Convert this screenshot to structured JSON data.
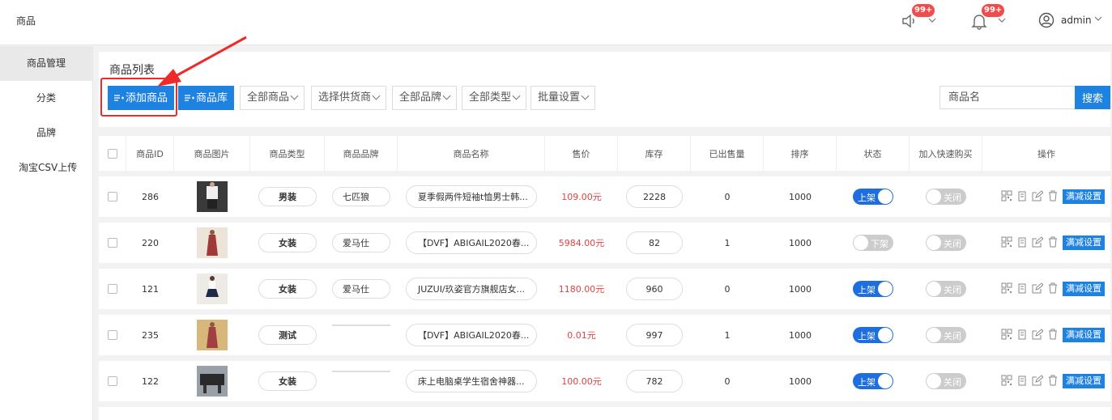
{
  "header": {
    "title": "商品",
    "notice_badge": "99+",
    "bell_badge": "99+",
    "user": "admin"
  },
  "sidebar": {
    "items": [
      {
        "label": "商品管理",
        "active": true
      },
      {
        "label": "分类"
      },
      {
        "label": "品牌"
      },
      {
        "label": "淘宝CSV上传"
      }
    ]
  },
  "panel": {
    "title": "商品列表",
    "add_label": "添加商品",
    "library_label": "商品库",
    "filters": [
      "全部商品",
      "选择供货商",
      "全部品牌",
      "全部类型",
      "批量设置"
    ],
    "search_placeholder": "商品名",
    "search_label": "搜索"
  },
  "table": {
    "headers": [
      "商品ID",
      "商品图片",
      "商品类型",
      "商品品牌",
      "商品名称",
      "售价",
      "库存",
      "已出售量",
      "排序",
      "状态",
      "加入快速购买",
      "操作"
    ],
    "rows": [
      {
        "id": "286",
        "type": "男装",
        "brand": "七匹狼",
        "name": "夏季假两件短袖t恤男士韩...",
        "price": "109.00元",
        "stock": "2228",
        "sold": "0",
        "sort": "1000",
        "status": "上架",
        "status_on": true,
        "quick": "关闭",
        "action": "满减设置"
      },
      {
        "id": "220",
        "type": "女装",
        "brand": "爱马仕",
        "name": "【DVF】ABIGAIL2020春...",
        "price": "5984.00元",
        "stock": "82",
        "sold": "1",
        "sort": "1000",
        "status": "下架",
        "status_on": false,
        "quick": "关闭",
        "action": "满减设置"
      },
      {
        "id": "121",
        "type": "女装",
        "brand": "爱马仕",
        "name": "JUZUI/玖姿官方旗舰店女...",
        "price": "1180.00元",
        "stock": "960",
        "sold": "0",
        "sort": "1000",
        "status": "上架",
        "status_on": true,
        "quick": "关闭",
        "action": "满减设置"
      },
      {
        "id": "235",
        "type": "测试",
        "brand": "",
        "name": "【DVF】ABIGAIL2020春...",
        "price": "0.01元",
        "stock": "997",
        "sold": "1",
        "sort": "1000",
        "status": "上架",
        "status_on": true,
        "quick": "关闭",
        "action": "满减设置"
      },
      {
        "id": "122",
        "type": "女装",
        "brand": "",
        "name": "床上电脑桌学生宿舍神器...",
        "price": "100.00元",
        "stock": "782",
        "sold": "0",
        "sort": "1000",
        "status": "上架",
        "status_on": true,
        "quick": "关闭",
        "action": "满减设置"
      }
    ]
  },
  "colors": {
    "primary": "#1e82e0",
    "price": "#e24141",
    "highlight": "#ee2a2a",
    "badge": "#f24b4b"
  }
}
